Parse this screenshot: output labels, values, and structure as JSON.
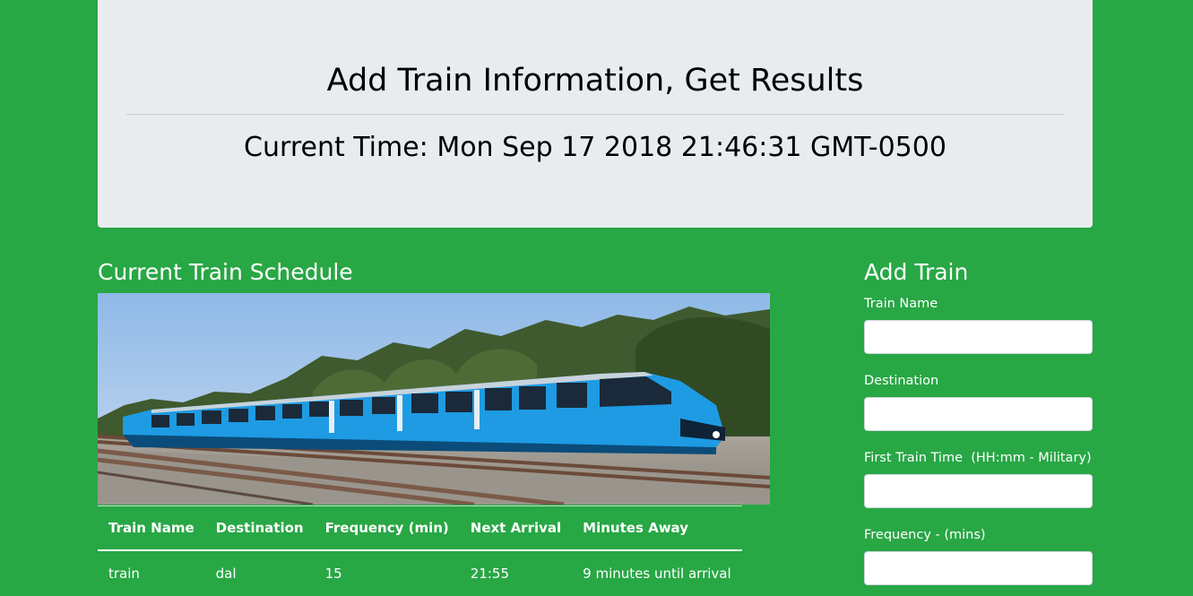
{
  "header": {
    "title": "Add Train Information, Get Results",
    "current_time": "Current Time: Mon Sep 17 2018 21:46:31 GMT-0500"
  },
  "schedule": {
    "title": "Current Train Schedule",
    "columns": [
      "Train Name",
      "Destination",
      "Frequency (min)",
      "Next Arrival",
      "Minutes Away"
    ],
    "rows": [
      [
        "train",
        "dal",
        "15",
        "21:55",
        "9 minutes until arrival"
      ]
    ]
  },
  "add_train": {
    "title": "Add Train",
    "fields": [
      {
        "label": "Train Name",
        "value": ""
      },
      {
        "label": "Destination",
        "value": ""
      },
      {
        "label": "First Train Time  (HH:mm - Military)",
        "value": ""
      },
      {
        "label": "Frequency - (mins)",
        "value": ""
      }
    ]
  },
  "colors": {
    "page_background": "#28a745",
    "jumbotron": "#e9ecef",
    "train_body": "#1e9be3"
  }
}
